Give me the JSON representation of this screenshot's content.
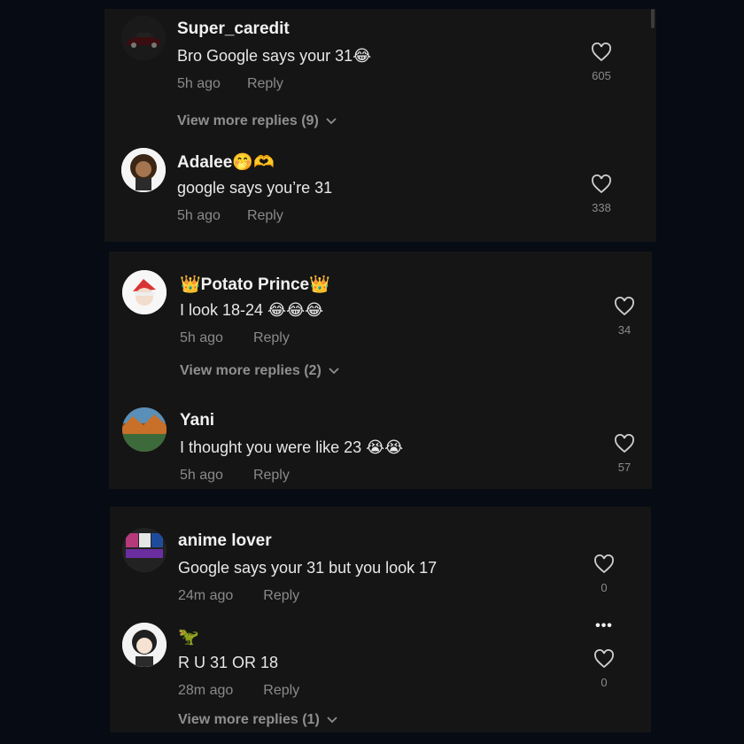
{
  "panels": [
    {
      "comments": [
        {
          "username": "Super_caredit",
          "text": "Bro Google says your 31😂",
          "time": "5h ago",
          "reply": "Reply",
          "likes": "605",
          "avatar_icon": "car-avatar-icon"
        },
        {
          "username": "Adalee🤭🫶",
          "text": "google says you’re 31",
          "time": "5h ago",
          "reply": "Reply",
          "likes": "338",
          "avatar_icon": "cartoon-girl-avatar-icon"
        }
      ],
      "view_more": "View more replies (9)"
    },
    {
      "comments": [
        {
          "username": "👑Potato Prince👑",
          "text": "I look 18-24 😂😂😂",
          "time": "5h ago",
          "reply": "Reply",
          "likes": "34",
          "avatar_icon": "anime-santa-avatar-icon"
        },
        {
          "username": "Yani",
          "text": "I thought you were like 23 😭😭",
          "time": "5h ago",
          "reply": "Reply",
          "likes": "57",
          "avatar_icon": "landscape-avatar-icon"
        }
      ],
      "view_more": "View more replies (2)"
    },
    {
      "comments": [
        {
          "username": "anime lover",
          "text": "Google says your 31 but you look 17",
          "time": "24m ago",
          "reply": "Reply",
          "likes": "0",
          "avatar_icon": "anime-collage-avatar-icon"
        },
        {
          "username": "🦖",
          "text": "R U 31 OR 18",
          "time": "28m ago",
          "reply": "Reply",
          "likes": "0",
          "avatar_icon": "anime-girl-avatar-icon",
          "more_options": "•••"
        }
      ],
      "view_more": "View more replies (1)"
    }
  ],
  "colors": {
    "background": "#060b14",
    "panel": "#151515",
    "text_primary": "#f1f1f1",
    "text_secondary": "#8a8a8a"
  }
}
